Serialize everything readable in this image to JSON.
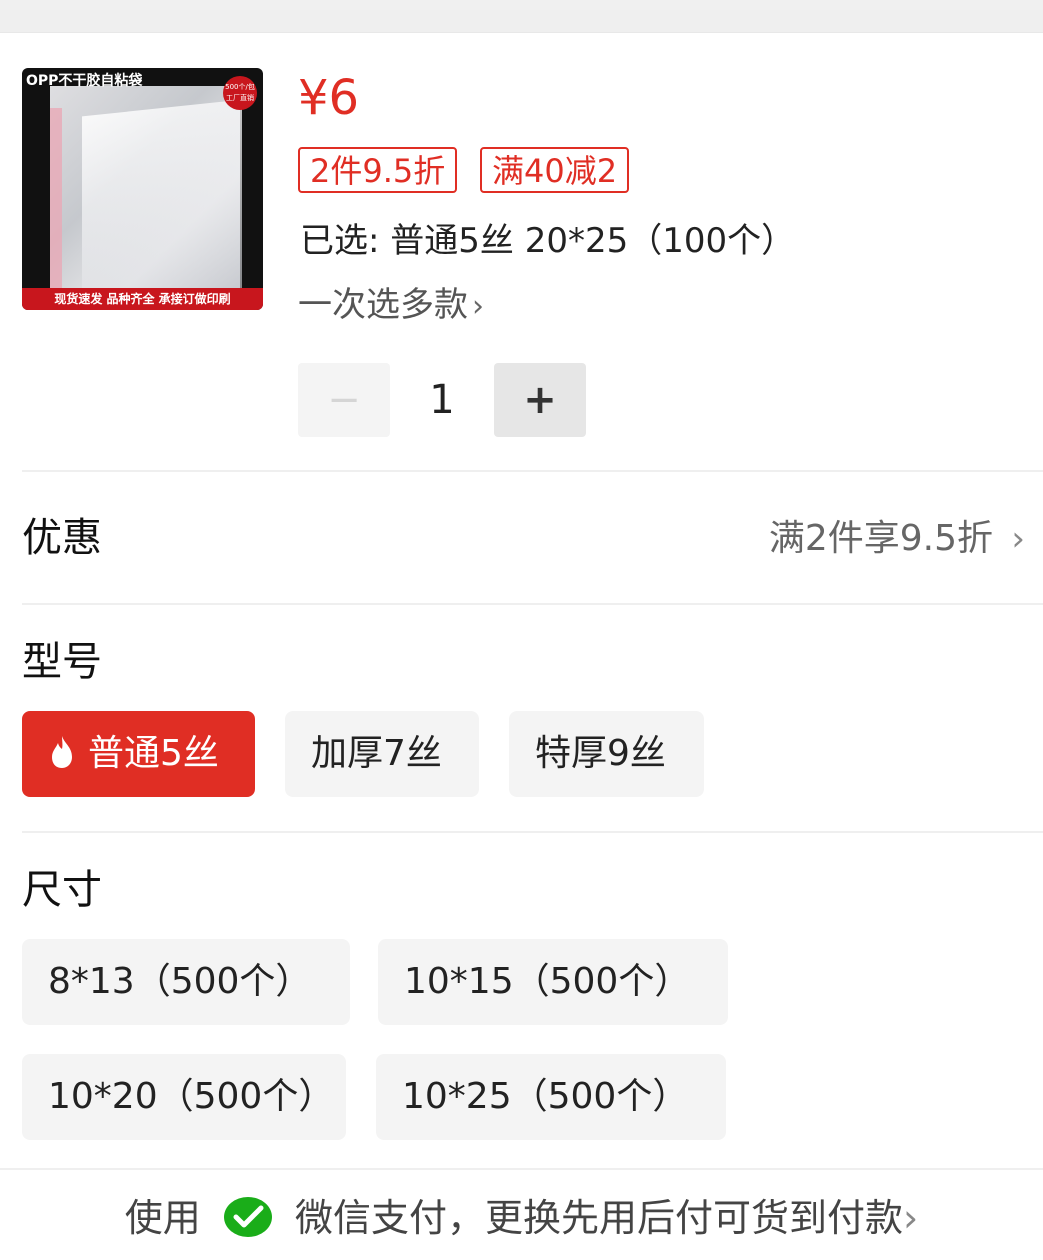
{
  "product": {
    "image_title": "OPP不干胶自粘袋",
    "image_seal_top": "500个/包",
    "image_seal_bottom": "工厂直销",
    "image_footer": "现货速发  品种齐全  承接订做印刷",
    "price": "¥6",
    "tags": [
      "2件9.5折",
      "满40减2"
    ],
    "selected_label": "已选:",
    "selected_value": "普通5丝 20*25（100个）",
    "multi_select": "一次选多款",
    "quantity": "1",
    "minus": "−",
    "plus": "+"
  },
  "promo": {
    "title": "优惠",
    "value": "满2件享9.5折"
  },
  "model": {
    "title": "型号",
    "options": [
      "普通5丝",
      "加厚7丝",
      "特厚9丝"
    ],
    "selected_index": 0
  },
  "size": {
    "title": "尺寸",
    "options": [
      "8*13（500个）",
      "10*15（500个）",
      "10*20（500个）",
      "10*25（500个）"
    ]
  },
  "payment": {
    "prefix": "使用",
    "text": "微信支付，更换先用后付可货到付款"
  },
  "colors": {
    "accent": "#e02e24",
    "wechat": "#1aad19"
  }
}
